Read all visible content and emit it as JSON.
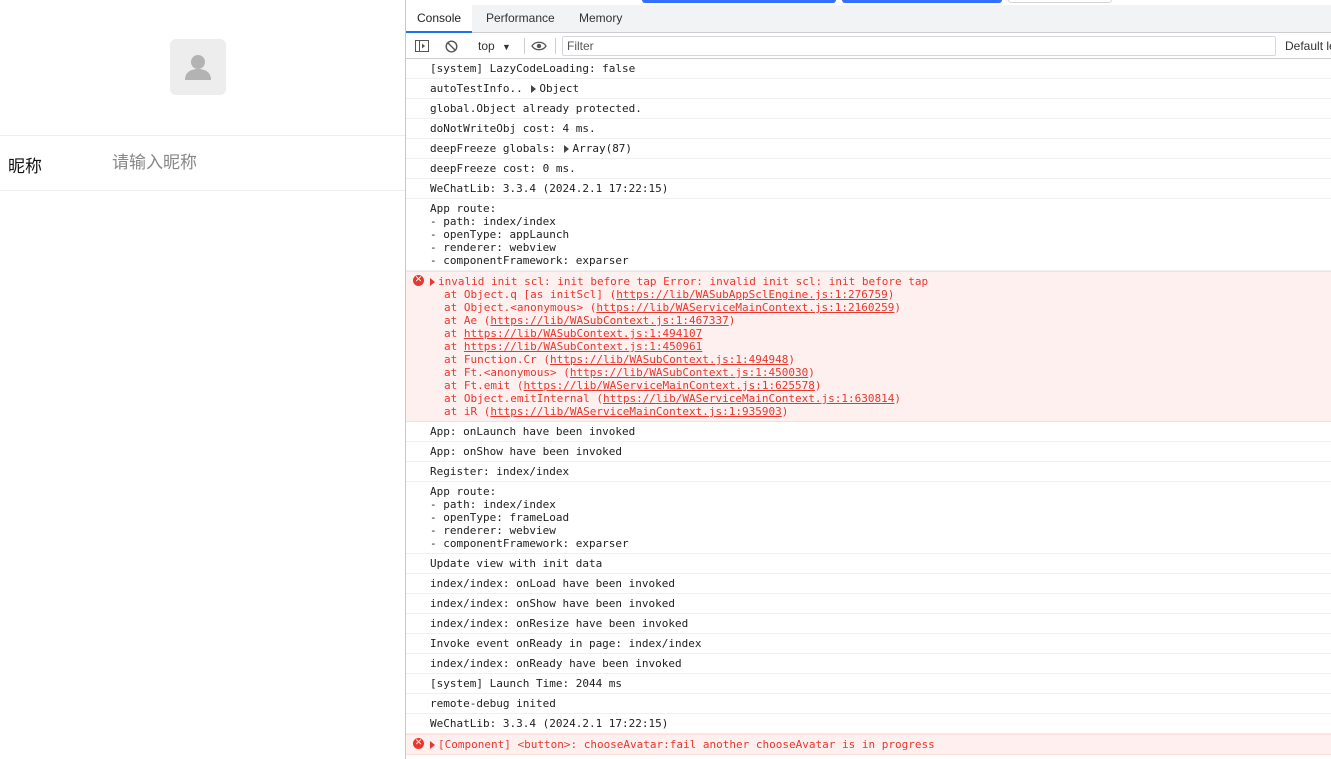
{
  "simulator": {
    "nickname_label": "昵称",
    "nickname_placeholder": "请输入昵称"
  },
  "devtools": {
    "tabs": [
      {
        "label": "Console",
        "active": true
      },
      {
        "label": "Performance",
        "active": false
      },
      {
        "label": "Memory",
        "active": false
      }
    ],
    "toolbar": {
      "context": "top",
      "filter_placeholder": "Filter",
      "levels_label": "Default le"
    },
    "colors": {
      "accent": "#1a73e8",
      "error": "#e8372e",
      "error_bg": "#fff0f0"
    },
    "logs": [
      {
        "type": "log",
        "text": "[system] LazyCodeLoading: false"
      },
      {
        "type": "log",
        "text": "autoTestInfo.. ",
        "object": "Object"
      },
      {
        "type": "log",
        "text": "global.Object already protected."
      },
      {
        "type": "log",
        "text": "doNotWriteObj cost: 4 ms."
      },
      {
        "type": "log",
        "text": "deepFreeze globals: ",
        "object": "Array(87)"
      },
      {
        "type": "log",
        "text": "deepFreeze cost: 0 ms."
      },
      {
        "type": "log",
        "text": "WeChatLib: 3.3.4 (2024.2.1 17:22:15)"
      },
      {
        "type": "multi",
        "lines": [
          "App route:",
          "- path: index/index",
          "- openType: appLaunch",
          "- renderer: webview",
          "- componentFramework: exparser"
        ]
      },
      {
        "type": "error",
        "message": "invalid init scl: init before tap Error: invalid init scl: init before tap",
        "stack": [
          {
            "pre": "at Object.q [as initScl] (",
            "link": "https://lib/WASubAppSclEngine.js:1:276759",
            "post": ")"
          },
          {
            "pre": "at Object.<anonymous> (",
            "link": "https://lib/WAServiceMainContext.js:1:2160259",
            "post": ")"
          },
          {
            "pre": "at Ae (",
            "link": "https://lib/WASubContext.js:1:467337",
            "post": ")"
          },
          {
            "pre": "at ",
            "link": "https://lib/WASubContext.js:1:494107",
            "post": ""
          },
          {
            "pre": "at ",
            "link": "https://lib/WASubContext.js:1:450961",
            "post": ""
          },
          {
            "pre": "at Function.Cr (",
            "link": "https://lib/WASubContext.js:1:494948",
            "post": ")"
          },
          {
            "pre": "at Ft.<anonymous> (",
            "link": "https://lib/WASubContext.js:1:450030",
            "post": ")"
          },
          {
            "pre": "at Ft.emit (",
            "link": "https://lib/WAServiceMainContext.js:1:625578",
            "post": ")"
          },
          {
            "pre": "at Object.emitInternal (",
            "link": "https://lib/WAServiceMainContext.js:1:630814",
            "post": ")"
          },
          {
            "pre": "at iR (",
            "link": "https://lib/WAServiceMainContext.js:1:935903",
            "post": ")"
          }
        ]
      },
      {
        "type": "log",
        "text": "App: onLaunch have been invoked"
      },
      {
        "type": "log",
        "text": "App: onShow have been invoked"
      },
      {
        "type": "log",
        "text": "Register: index/index"
      },
      {
        "type": "multi",
        "lines": [
          "App route:",
          "- path: index/index",
          "- openType: frameLoad",
          "- renderer: webview",
          "- componentFramework: exparser"
        ]
      },
      {
        "type": "log",
        "text": "Update view with init data"
      },
      {
        "type": "log",
        "text": "index/index: onLoad have been invoked"
      },
      {
        "type": "log",
        "text": "index/index: onShow have been invoked"
      },
      {
        "type": "log",
        "text": "index/index: onResize have been invoked"
      },
      {
        "type": "log",
        "text": "Invoke event onReady in page: index/index"
      },
      {
        "type": "log",
        "text": "index/index: onReady have been invoked"
      },
      {
        "type": "log",
        "text": "[system] Launch Time: 2044 ms"
      },
      {
        "type": "log",
        "text": "remote-debug inited"
      },
      {
        "type": "log",
        "text": "WeChatLib: 3.3.4 (2024.2.1 17:22:15)"
      },
      {
        "type": "error",
        "message": "[Component] <button>: chooseAvatar:fail another chooseAvatar is in progress",
        "stack": []
      }
    ],
    "prompt_symbol": "›"
  }
}
